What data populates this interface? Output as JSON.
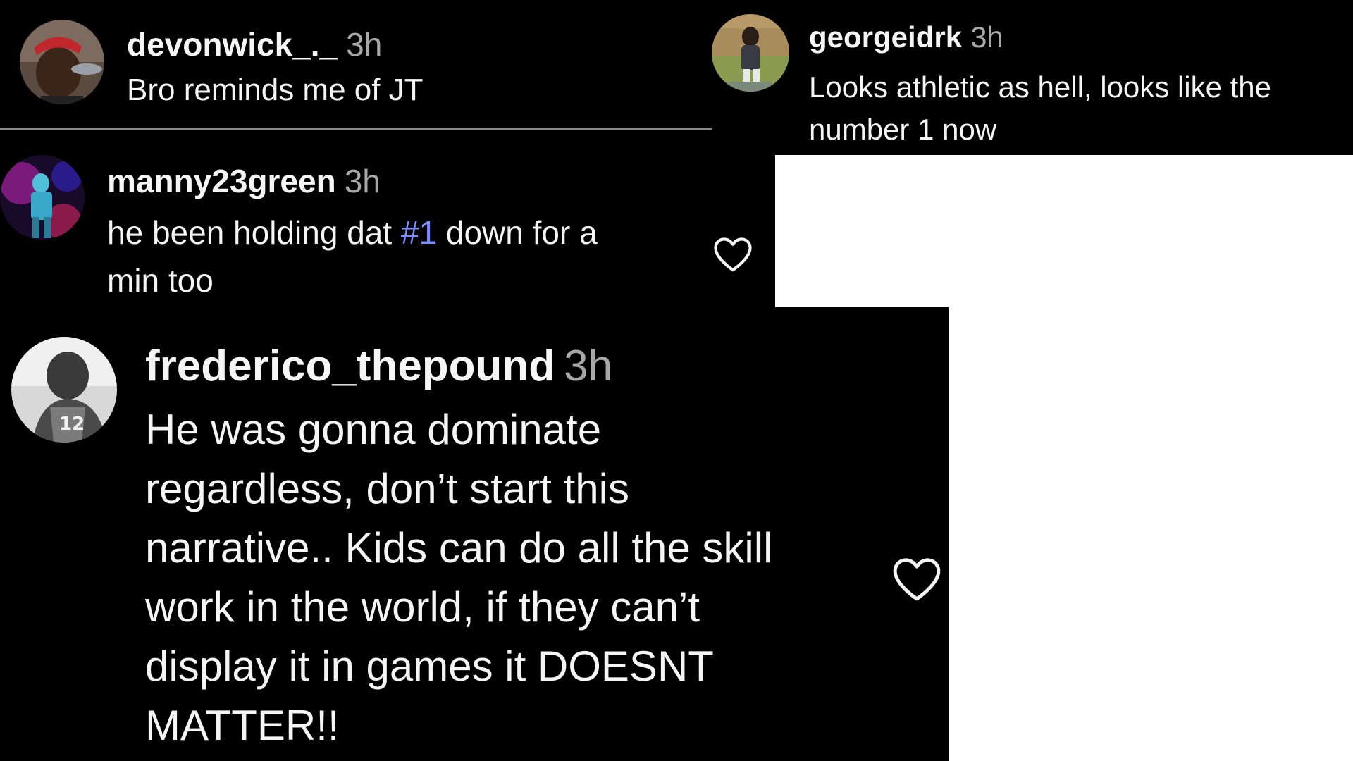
{
  "comments": [
    {
      "username": "devonwick_._",
      "time": "3h",
      "text": "Bro reminds me of JT",
      "avatar_icon": "profile-photo-red-cap"
    },
    {
      "username": "georgeidrk",
      "time": "3h",
      "text_line1": "Looks athletic as hell, looks like the",
      "text_line2": "number 1 now",
      "avatar_icon": "profile-photo-football-player-field"
    },
    {
      "username": "manny23green",
      "time": "3h",
      "text_before": "he been holding dat ",
      "hashtag": "#1",
      "text_after": " down for a",
      "text_line2": "min too",
      "avatar_icon": "profile-photo-stage-lights",
      "like_icon": "heart-outline-icon"
    },
    {
      "username": "frederico_thepound",
      "time": "3h",
      "text_lines": [
        "He was gonna dominate",
        "regardless, don’t start this",
        "narrative.. Kids can do all the skill",
        "work in the world, if they can’t",
        "display it in games it DOESNT",
        "MATTER!!"
      ],
      "avatar_icon": "profile-photo-bw-jersey-12",
      "like_icon": "heart-outline-icon"
    }
  ],
  "colors": {
    "background": "#000000",
    "text": "#f5f5f5",
    "timestamp": "#a8a8a8",
    "hashtag": "#7b8cff",
    "divider": "#8a8a8a"
  }
}
